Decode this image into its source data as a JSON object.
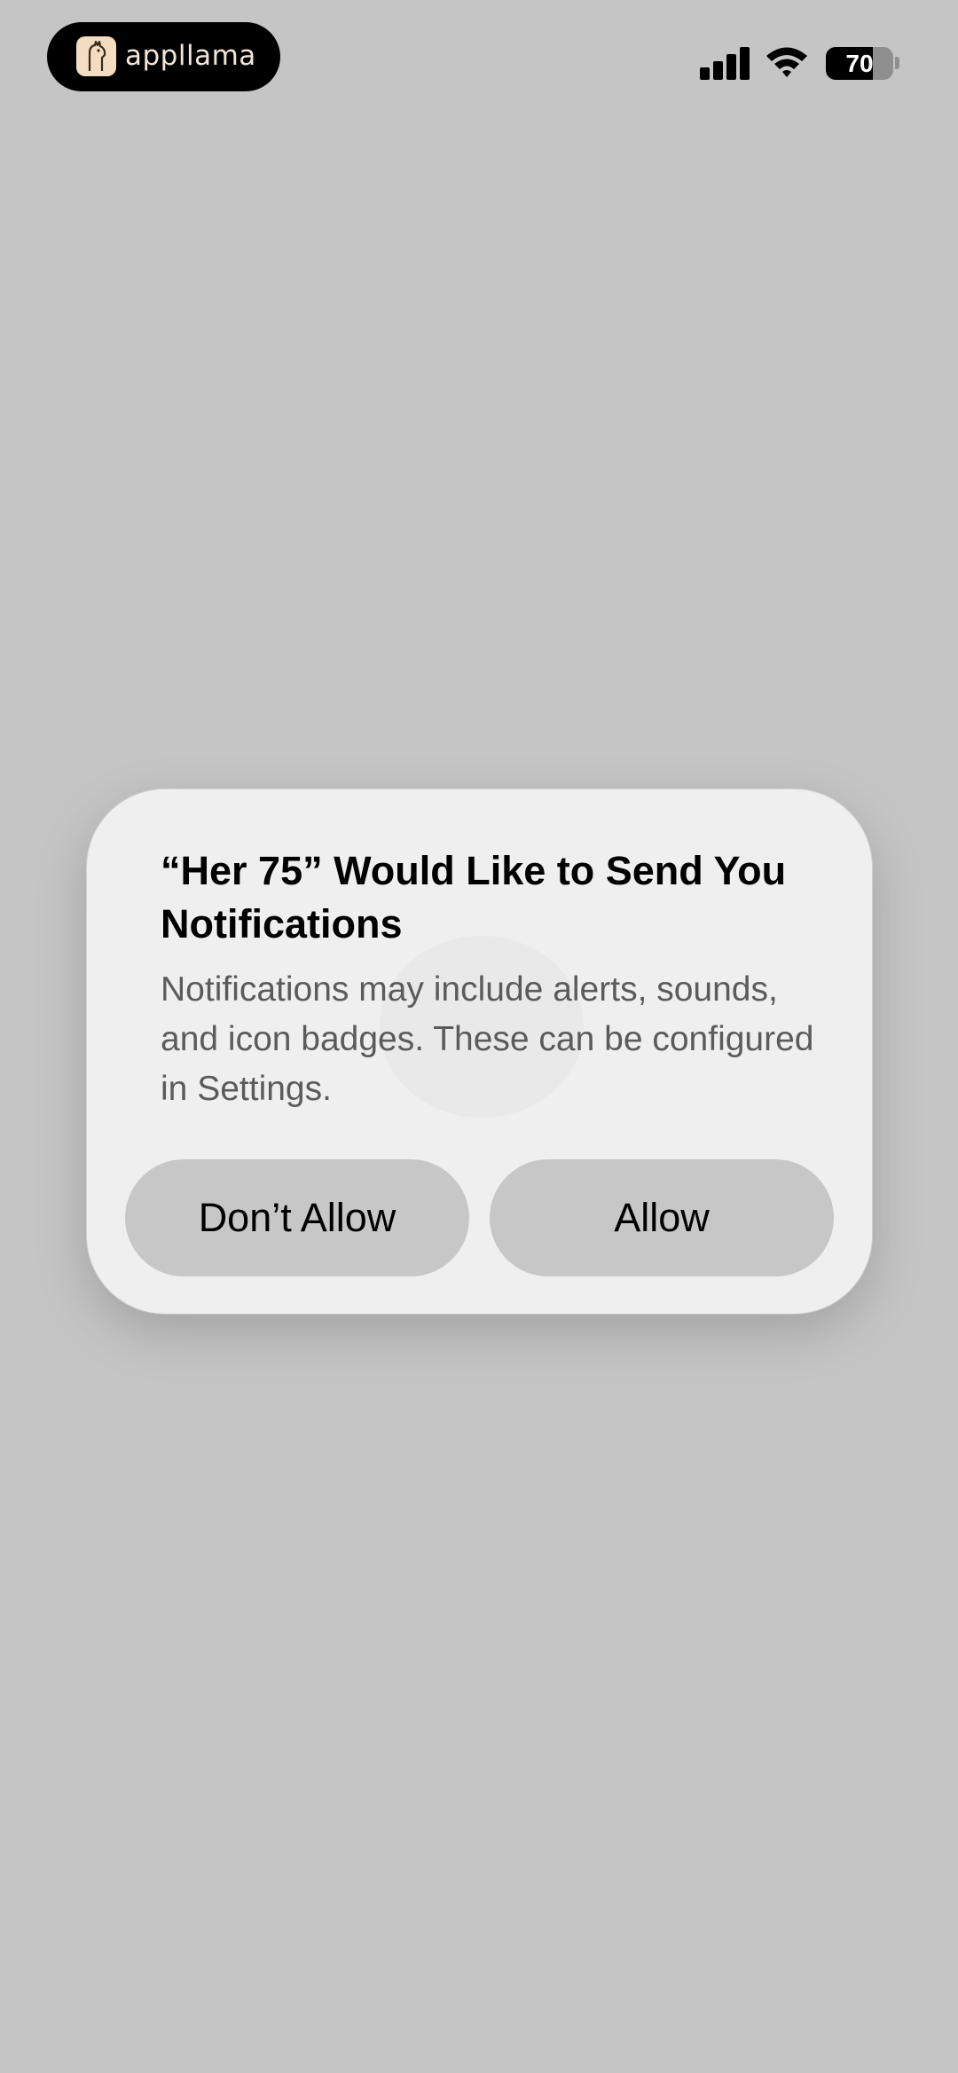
{
  "status_bar": {
    "app_name": "appllama",
    "battery_level": "70",
    "battery_fraction": 0.7
  },
  "dialog": {
    "title": "“Her 75” Would Like to Send You Notifications",
    "message": "Notifications may include alerts, sounds, and icon badges. These can be configured in Settings.",
    "deny_label": "Don’t Allow",
    "allow_label": "Allow"
  },
  "colors": {
    "background": "#c5c5c5",
    "dialog": "#efefef",
    "button": "#c7c7c7"
  }
}
